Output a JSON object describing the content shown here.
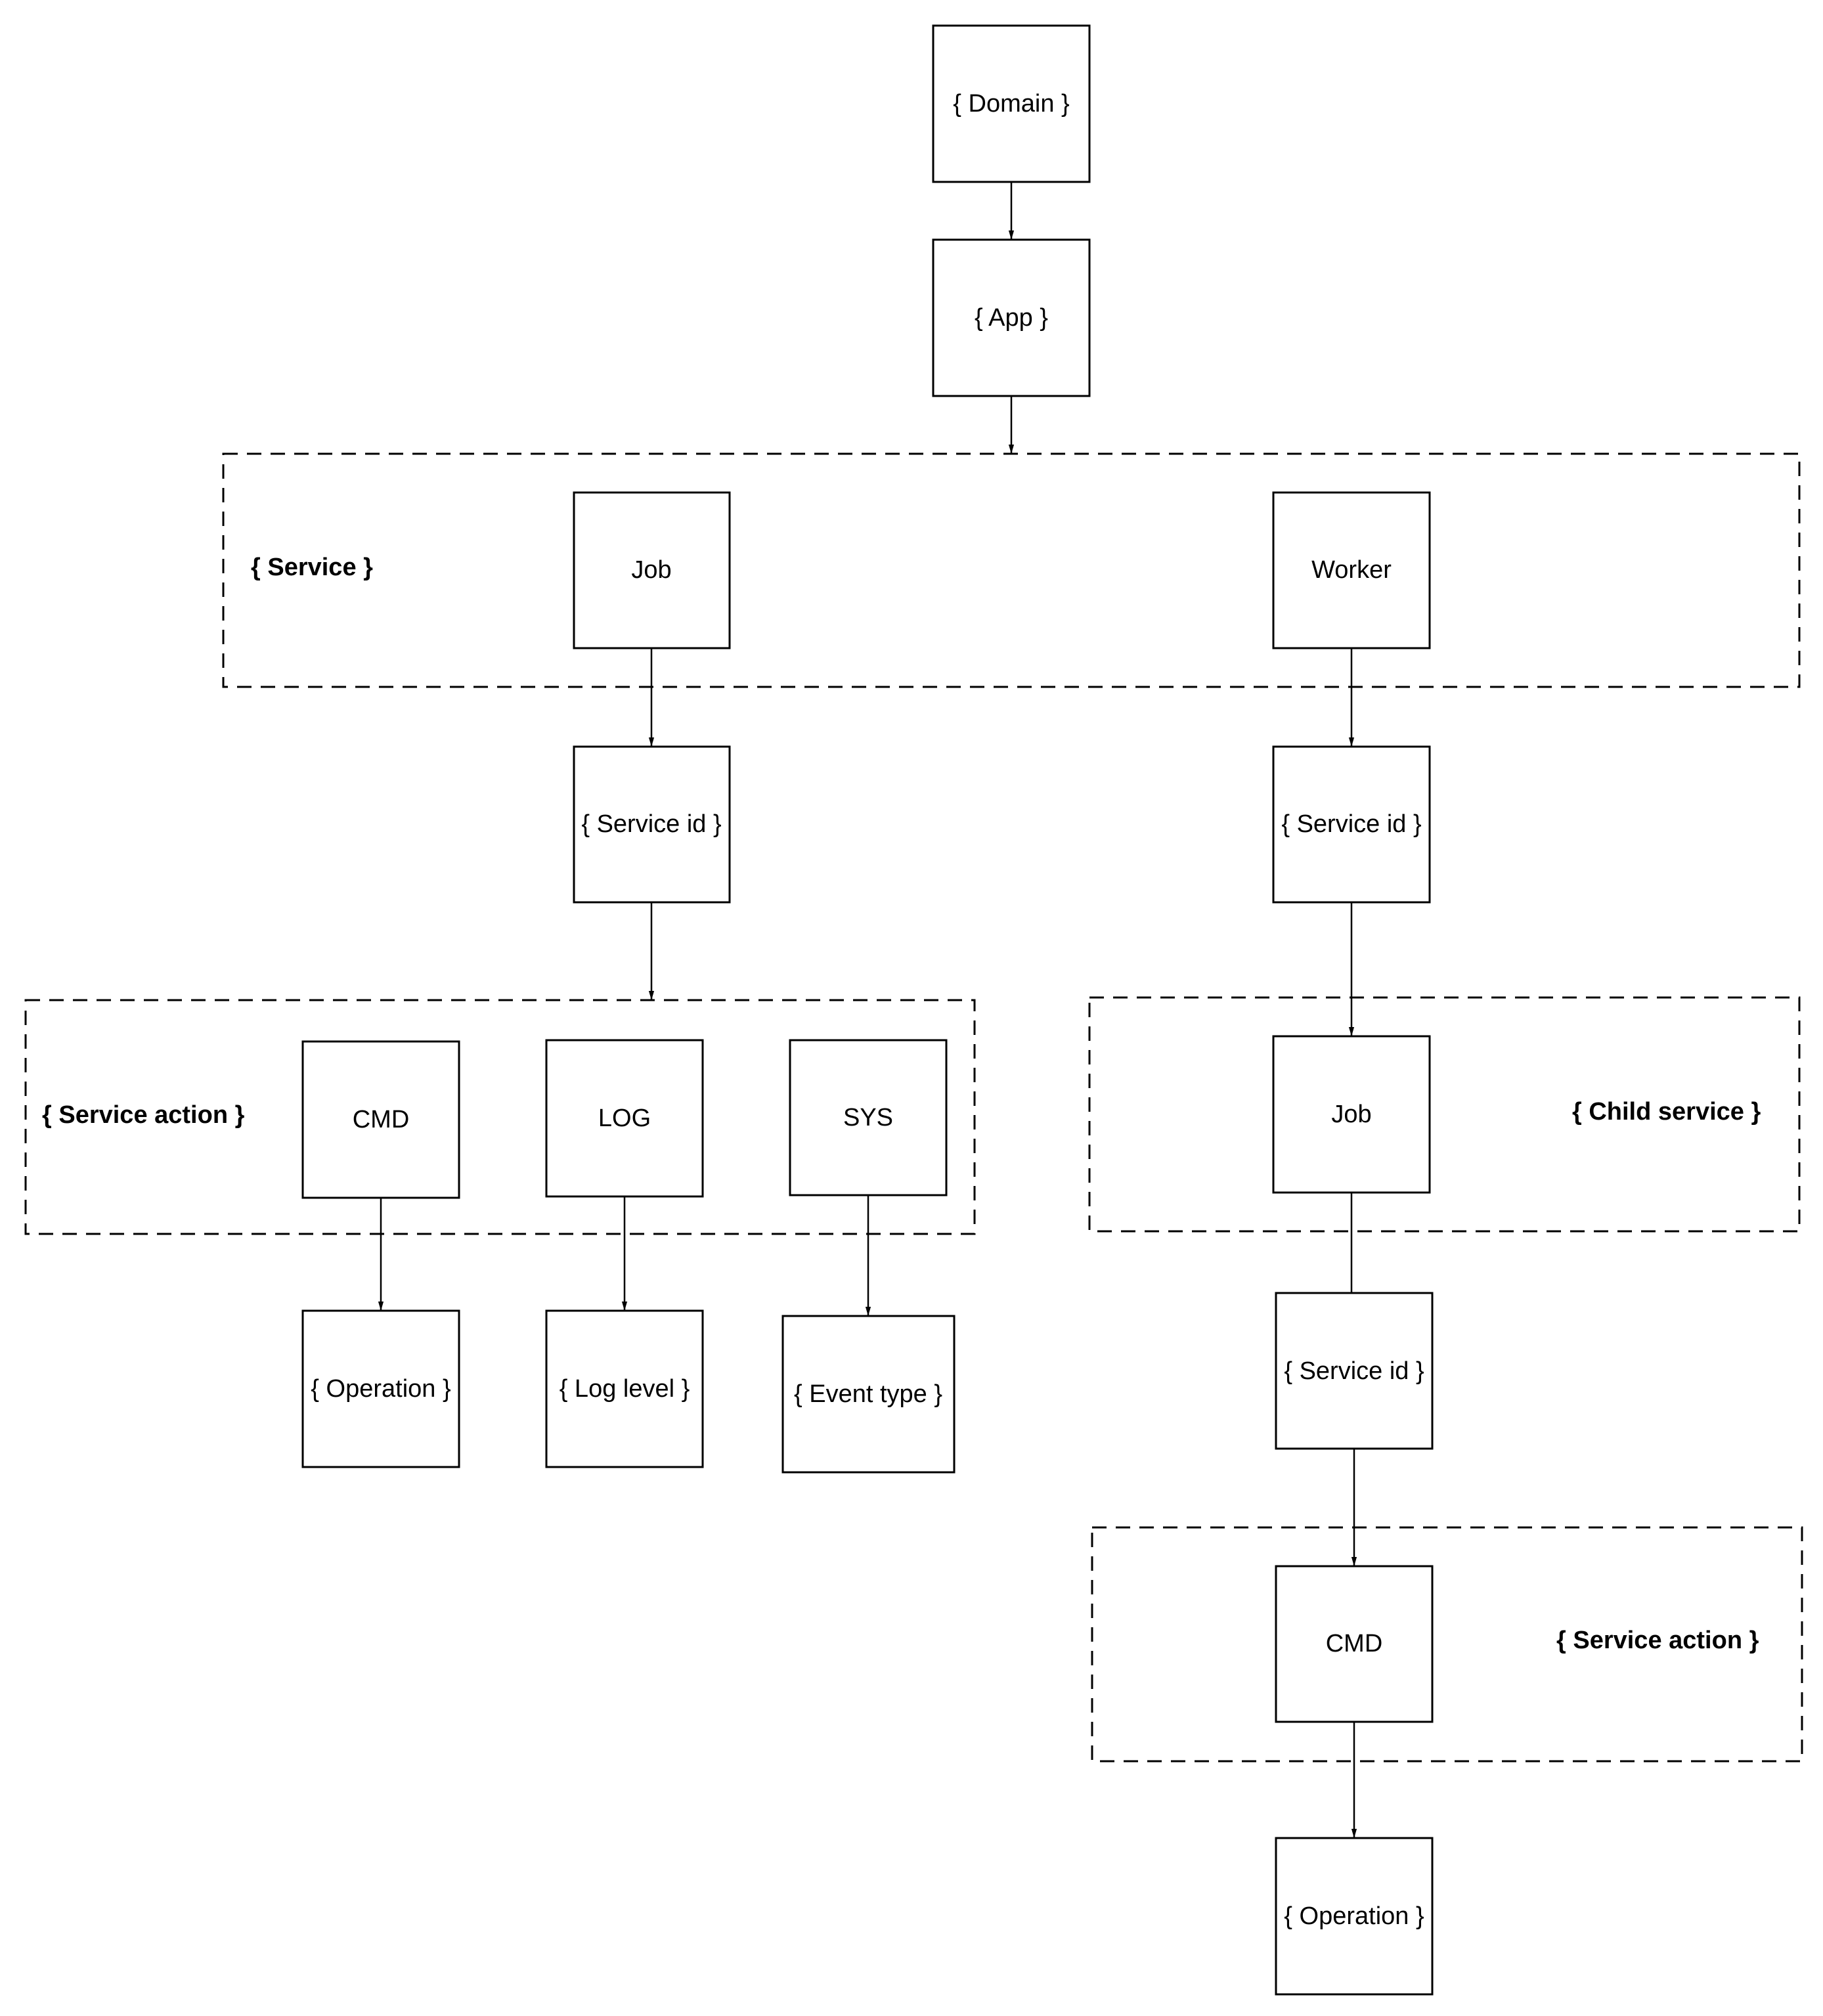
{
  "diagram": {
    "nodes": [
      {
        "id": "domain",
        "label": "{ Domain }"
      },
      {
        "id": "app",
        "label": "{ App }"
      },
      {
        "id": "service_job",
        "label": "Job"
      },
      {
        "id": "service_worker",
        "label": "Worker"
      },
      {
        "id": "job_service_id",
        "label": "{ Service id }"
      },
      {
        "id": "worker_service_id",
        "label": "{ Service id }"
      },
      {
        "id": "action_cmd",
        "label": "CMD"
      },
      {
        "id": "action_log",
        "label": "LOG"
      },
      {
        "id": "action_sys",
        "label": "SYS"
      },
      {
        "id": "operation",
        "label": "{ Operation }"
      },
      {
        "id": "log_level",
        "label": "{ Log level }"
      },
      {
        "id": "event_type",
        "label": "{ Event type }"
      },
      {
        "id": "child_job",
        "label": "Job"
      },
      {
        "id": "child_service_id",
        "label": "{ Service id }"
      },
      {
        "id": "child_action_cmd",
        "label": "CMD"
      },
      {
        "id": "child_operation",
        "label": "{ Operation }"
      }
    ],
    "groups": [
      {
        "id": "service",
        "label": "{ Service }",
        "members": [
          "service_job",
          "service_worker"
        ]
      },
      {
        "id": "service_action_left",
        "label": "{ Service action }",
        "members": [
          "action_cmd",
          "action_log",
          "action_sys"
        ]
      },
      {
        "id": "child_service",
        "label": "{ Child service }",
        "members": [
          "child_job"
        ]
      },
      {
        "id": "service_action_right",
        "label": "{ Service action }",
        "members": [
          "child_action_cmd"
        ]
      }
    ],
    "edges": [
      {
        "from": "domain",
        "to": "app",
        "arrow": true
      },
      {
        "from": "app",
        "to": "service",
        "arrow": true
      },
      {
        "from": "service_job",
        "to": "job_service_id",
        "arrow": true
      },
      {
        "from": "service_worker",
        "to": "worker_service_id",
        "arrow": true
      },
      {
        "from": "job_service_id",
        "to": "service_action_left",
        "arrow": true
      },
      {
        "from": "worker_service_id",
        "to": "child_job",
        "arrow": true
      },
      {
        "from": "action_cmd",
        "to": "operation",
        "arrow": true
      },
      {
        "from": "action_log",
        "to": "log_level",
        "arrow": true
      },
      {
        "from": "action_sys",
        "to": "event_type",
        "arrow": true
      },
      {
        "from": "child_job",
        "to": "child_service_id",
        "arrow": false
      },
      {
        "from": "child_service_id",
        "to": "child_action_cmd",
        "arrow": true
      },
      {
        "from": "child_action_cmd",
        "to": "child_operation",
        "arrow": true
      }
    ]
  }
}
